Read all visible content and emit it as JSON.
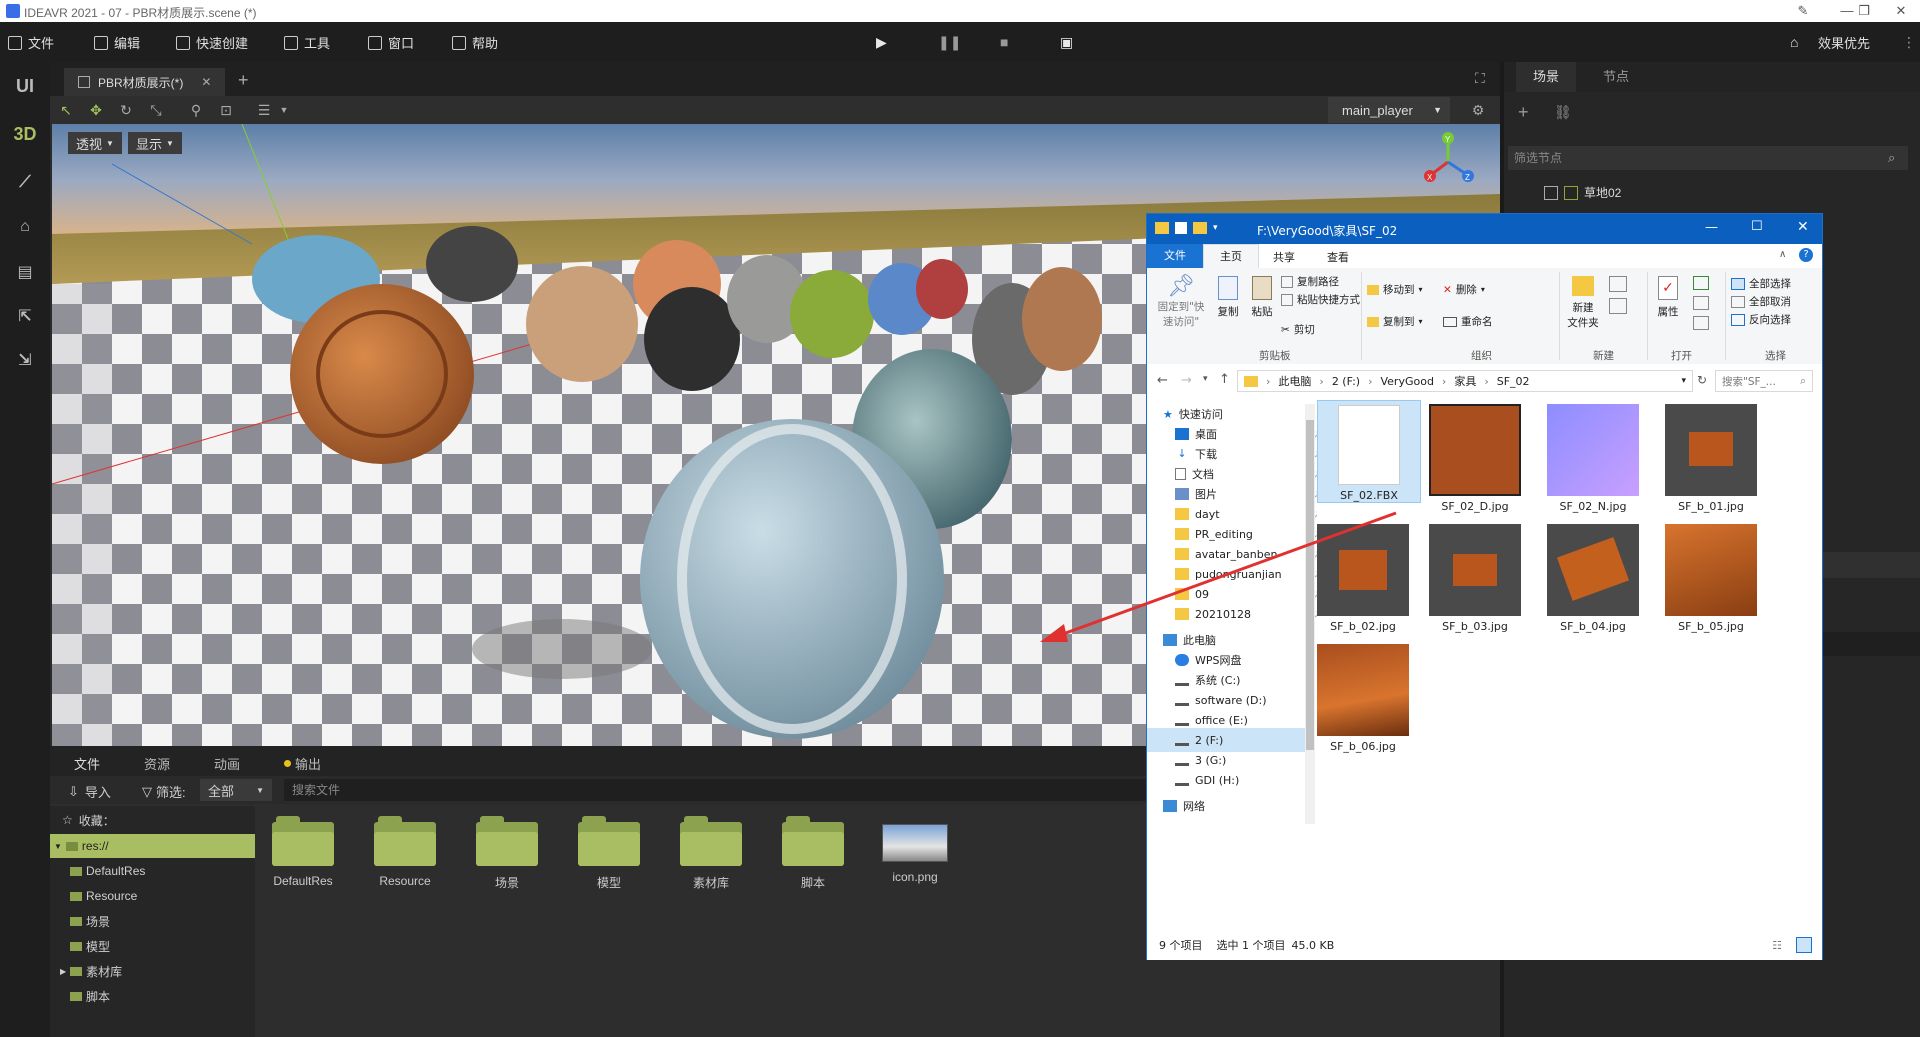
{
  "window": {
    "title": "IDEAVR 2021 - 07 - PBR材质展示.scene (*)"
  },
  "menu": {
    "items": [
      "文件",
      "编辑",
      "快速创建",
      "工具",
      "窗口",
      "帮助"
    ],
    "right": "效果优先"
  },
  "left_toolbar": {
    "ui": "UI",
    "threed": "3D"
  },
  "scene_tab": {
    "label": "PBR材质展示(*)",
    "add": "+"
  },
  "viewport": {
    "player": "main_player",
    "view_btn": "透视",
    "display_btn": "显示",
    "axis_y": "Y",
    "axis_x": "X",
    "axis_z": "Z"
  },
  "bottom": {
    "tabs": [
      "文件",
      "资源",
      "动画",
      "输出"
    ],
    "import": "导入",
    "filter_label": "筛选:",
    "filter_value": "全部",
    "search_placeholder": "搜索文件",
    "tree": {
      "favorites": "收藏：",
      "root": "res://",
      "items": [
        "DefaultRes",
        "Resource",
        "场景",
        "模型",
        "素材库",
        "脚本"
      ]
    },
    "files": [
      "DefaultRes",
      "Resource",
      "场景",
      "模型",
      "素材库",
      "脚本",
      "icon.png"
    ]
  },
  "right_panel": {
    "tabs": [
      "场景",
      "节点"
    ],
    "filter_placeholder": "筛选节点",
    "node": "草地02"
  },
  "explorer": {
    "path_title": "F:\\VeryGood\\家具\\SF_02",
    "tabs": [
      "文件",
      "主页",
      "共享",
      "查看"
    ],
    "ribbon": {
      "pin": "固定到\"快\n速访问\"",
      "copy": "复制",
      "paste": "粘贴",
      "copy_path": "复制路径",
      "paste_shortcut": "粘贴快捷方式",
      "cut": "剪切",
      "clipboard": "剪贴板",
      "move_to": "移动到",
      "copy_to": "复制到",
      "delete": "删除",
      "rename": "重命名",
      "organize": "组织",
      "new_folder": "新建\n文件夹",
      "new": "新建",
      "properties": "属性",
      "open": "打开",
      "select_all": "全部选择",
      "select_none": "全部取消",
      "invert": "反向选择",
      "select": "选择"
    },
    "breadcrumb": [
      "此电脑",
      "2 (F:)",
      "VeryGood",
      "家具",
      "SF_02"
    ],
    "search_placeholder": "搜索\"SF_...",
    "nav": {
      "quick_access": "快速访问",
      "quick_items": [
        "桌面",
        "下载",
        "文档",
        "图片",
        "dayt",
        "PR_editing",
        "avatar_banben",
        "pudongruanjian",
        "09",
        "20210128"
      ],
      "this_pc": "此电脑",
      "pc_items": [
        "WPS网盘",
        "系统 (C:)",
        "software (D:)",
        "office (E:)",
        "2 (F:)",
        "3 (G:)",
        "GDI (H:)"
      ],
      "network": "网络"
    },
    "files": [
      "SF_02.FBX",
      "SF_02_D.jpg",
      "SF_02_N.jpg",
      "SF_b_01.jpg",
      "SF_b_02.jpg",
      "SF_b_03.jpg",
      "SF_b_04.jpg",
      "SF_b_05.jpg",
      "SF_b_06.jpg"
    ],
    "status": {
      "count": "9 个项目",
      "selected": "选中 1 个项目",
      "size": "45.0 KB"
    }
  },
  "colors": {
    "accent_green": "#a9be63",
    "explorer_blue": "#0a5fbf",
    "arrow_red": "#e03030"
  }
}
